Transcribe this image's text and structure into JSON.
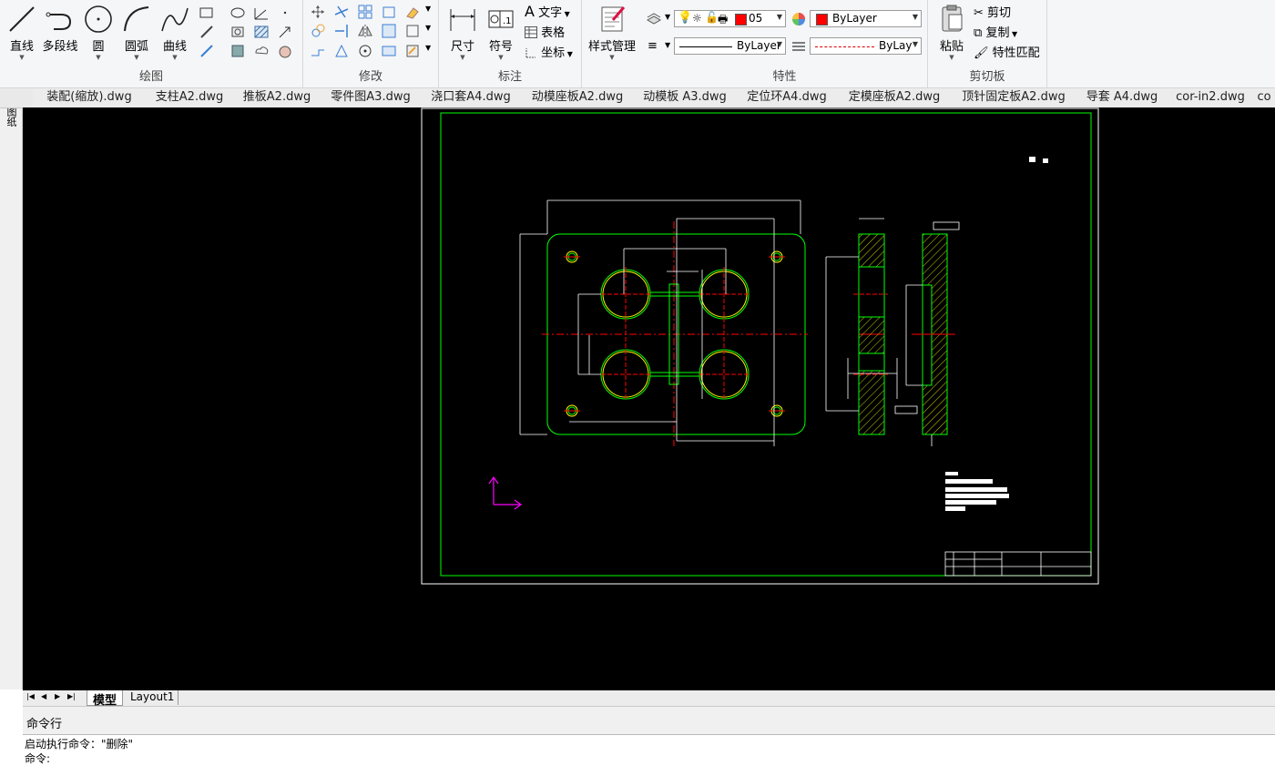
{
  "ribbon": {
    "draw": {
      "title": "绘图",
      "line": "直线",
      "polyline": "多段线",
      "circle": "圆",
      "arc": "圆弧",
      "curve": "曲线"
    },
    "modify": {
      "title": "修改"
    },
    "annotate": {
      "title": "标注",
      "dimension": "尺寸",
      "symbol": "符号",
      "text": "文字",
      "table": "表格",
      "coordinate": "坐标"
    },
    "style": {
      "label": "样式管理"
    },
    "properties": {
      "title": "特性",
      "layer_value": "05",
      "color_value": "ByLayer",
      "linetype_value": "ByLayer",
      "lineweight_value": "ByLay",
      "layer_color": "#ff0000",
      "color_swatch": "#ff0000"
    },
    "clipboard": {
      "title": "剪切板",
      "paste": "粘贴",
      "cut": "剪切",
      "copy": "复制",
      "match": "特性匹配"
    }
  },
  "tabs": [
    "装配(缩放).dwg",
    "支柱A2.dwg",
    "推板A2.dwg",
    "零件图A3.dwg",
    "浇口套A4.dwg",
    "动模座板A2.dwg",
    "动模板 A3.dwg",
    "定位环A4.dwg",
    "定模座板A2.dwg",
    "顶针固定板A2.dwg",
    "导套 A4.dwg",
    "cor-in2.dwg",
    "co"
  ],
  "sidebar": {
    "label": "图纸"
  },
  "layout_tabs": {
    "model": "模型",
    "layout1": "Layout1"
  },
  "command": {
    "title": "命令行",
    "history": "启动执行命令：\"删除\"",
    "prompt": "命令:"
  },
  "colors": {
    "frame": "#00ff00",
    "dim": "#ffffff",
    "center": "#ff0000",
    "holes": "#00ff00",
    "holes_inner": "#ffff00",
    "ucs": "#ff00ff"
  }
}
